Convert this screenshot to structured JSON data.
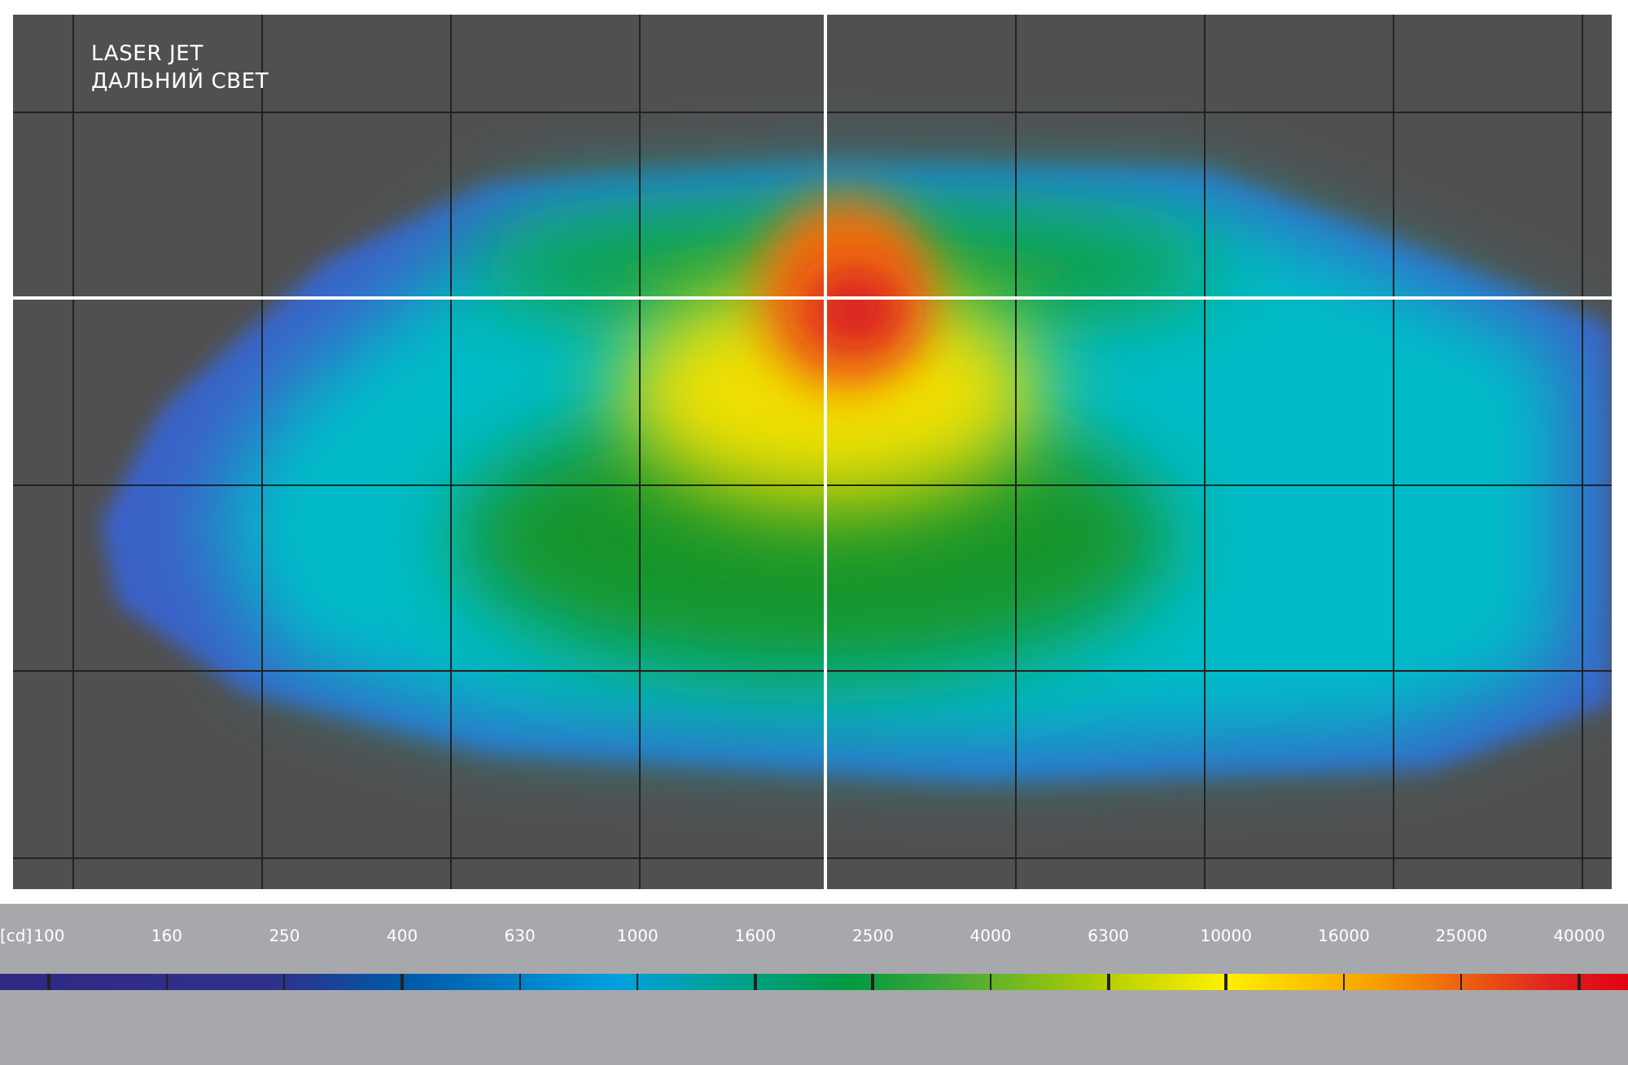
{
  "plot": {
    "title_lines": [
      "LASER JET",
      "ДАЛЬНИЙ СВЕТ"
    ]
  },
  "legend": {
    "unit": "[cd]",
    "values": [
      "100",
      "160",
      "250",
      "400",
      "630",
      "1000",
      "1600",
      "2500",
      "4000",
      "6300",
      "10000",
      "16000",
      "25000",
      "40000"
    ]
  }
}
